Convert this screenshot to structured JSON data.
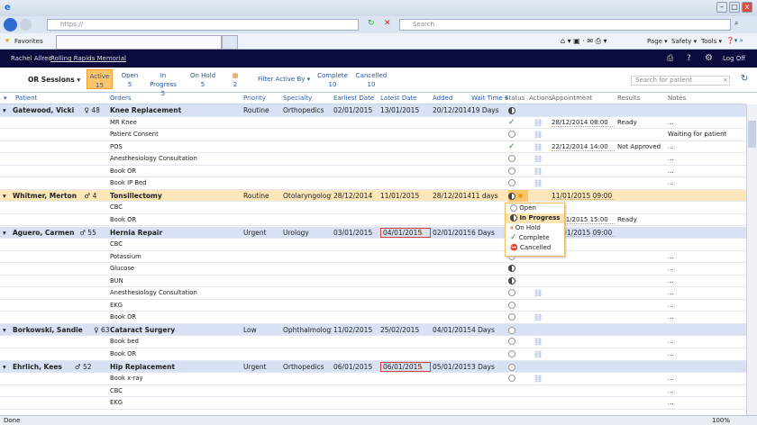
{
  "browser": {
    "address": "https://",
    "search_placeholder": "Search",
    "favorites": "Favorites",
    "menu": [
      "Page ▾",
      "Safety ▾",
      "Tools ▾"
    ],
    "status": "Done",
    "zoom": "100%"
  },
  "app": {
    "user": "Rachel Allred",
    "facility": "Rolling Rapids Memorial",
    "log_off": "Log Off"
  },
  "toolbar": {
    "sessions": "OR Sessions ▾",
    "filter": "Filter Active By ▾",
    "search_placeholder": "Search for patient",
    "counts": [
      {
        "label": "Active",
        "value": "15",
        "active": true
      },
      {
        "label": "Open",
        "value": "5"
      },
      {
        "label": "In Progress",
        "value": "5"
      },
      {
        "label": "On Hold",
        "value": "5"
      },
      {
        "label": "",
        "value": "2",
        "icon": "alert-calendar-icon"
      }
    ],
    "counts2": [
      {
        "label": "Complete",
        "value": "10"
      },
      {
        "label": "Cancelled",
        "value": "10"
      }
    ]
  },
  "columns": [
    "Patient",
    "Orders",
    "Priority",
    "Specialty",
    "Earliest Date",
    "Latest Date",
    "Added",
    "Wait Time ▾",
    "Status",
    "Actions",
    "Appointment",
    "Results",
    "Notes"
  ],
  "rows": [
    {
      "group": true,
      "patient": "Gatewood, Vicki",
      "sex": "♀",
      "age": "48",
      "order": "Knee Replacement",
      "priority": "Routine",
      "specialty": "Orthopedics",
      "earliest": "02/01/2015",
      "latest": "13/01/2015",
      "added": "20/12/2014",
      "wait": "19 Days",
      "status": "in-progress"
    },
    {
      "order": "MR Knee",
      "status": "complete",
      "link": true,
      "appt": "28/12/2014  08:00",
      "result": "Ready",
      "notes": "..."
    },
    {
      "order": "Patient Consent",
      "status": "open",
      "link": true,
      "notes": "Waiting for patient"
    },
    {
      "order": "POS",
      "status": "complete",
      "link": true,
      "appt": "22/12/2014 14:00",
      "result": "Not Approved",
      "notes": "..."
    },
    {
      "order": "Anesthesiology Consultation",
      "status": "open",
      "link": true,
      "notes": "..."
    },
    {
      "order": "Book OR",
      "status": "open",
      "link": true,
      "notes": "..."
    },
    {
      "order": "Book IP Bed",
      "status": "open",
      "link": true,
      "notes": "..."
    },
    {
      "group": true,
      "selected": true,
      "patient": "Whitmer, Merton",
      "sex": "♂",
      "age": "4",
      "order": "Tonsillectomy",
      "priority": "Routine",
      "specialty": "Otolaryngology",
      "earliest": "28/12/2014",
      "latest": "11/01/2015",
      "added": "28/12/2014",
      "wait": "11 days",
      "status": "in-progress",
      "appt": "11/01/2015 09:00"
    },
    {
      "order": "CBC",
      "status": "open"
    },
    {
      "order": "Book OR",
      "status": "open",
      "appt": "11/01/2015 15:00",
      "result": "Ready"
    },
    {
      "group": true,
      "patient": "Aguero, Carmen",
      "sex": "♂",
      "age": "55",
      "order": "Hernia Repair",
      "priority": "Urgent",
      "specialty": "Urology",
      "earliest": "03/01/2015",
      "latest": "04/01/2015",
      "latest_warn": true,
      "added": "02/01/2015",
      "wait": "6 Days",
      "status": "open",
      "appt": "11/01/2015 09:00"
    },
    {
      "order": "CBC",
      "status": "open"
    },
    {
      "order": "Potassium",
      "status": "open",
      "notes": "..."
    },
    {
      "order": "Glucose",
      "status": "in-progress",
      "notes": "..."
    },
    {
      "order": "BUN",
      "status": "in-progress",
      "notes": "..."
    },
    {
      "order": "Anesthesiology Consultation",
      "status": "open",
      "link": true,
      "notes": "..."
    },
    {
      "order": "EKG",
      "status": "open",
      "notes": "..."
    },
    {
      "order": "Book OR",
      "status": "open",
      "link": true,
      "notes": "..."
    },
    {
      "group": true,
      "patient": "Borkowski, Sandie",
      "sex": "♀",
      "age": "63",
      "order": "Cataract Surgery",
      "priority": "Low",
      "specialty": "Ophthalmology",
      "earliest": "11/02/2015",
      "latest": "25/02/2015",
      "added": "04/01/2015",
      "wait": "4 Days",
      "status": "open"
    },
    {
      "order": "Book bed",
      "status": "open",
      "link": true,
      "notes": "..."
    },
    {
      "order": "Book OR",
      "status": "open",
      "link": true,
      "notes": "..."
    },
    {
      "group": true,
      "patient": "Ehrlich, Kees",
      "sex": "♂",
      "age": "52",
      "order": "Hip Replacement",
      "priority": "Urgent",
      "specialty": "Orthopedics",
      "earliest": "06/01/2015",
      "latest": "06/01/2015",
      "latest_warn": true,
      "added": "05/01/2015",
      "wait": "3 Days",
      "status": "open"
    },
    {
      "order": "Book x-ray",
      "status": "open",
      "link": true,
      "notes": "..."
    },
    {
      "order": "CBC",
      "notes": "..."
    },
    {
      "order": "EKG",
      "notes": "..."
    }
  ],
  "status_menu": [
    "Open",
    "In Progress",
    "On Hold",
    "Complete",
    "Cancelled"
  ]
}
